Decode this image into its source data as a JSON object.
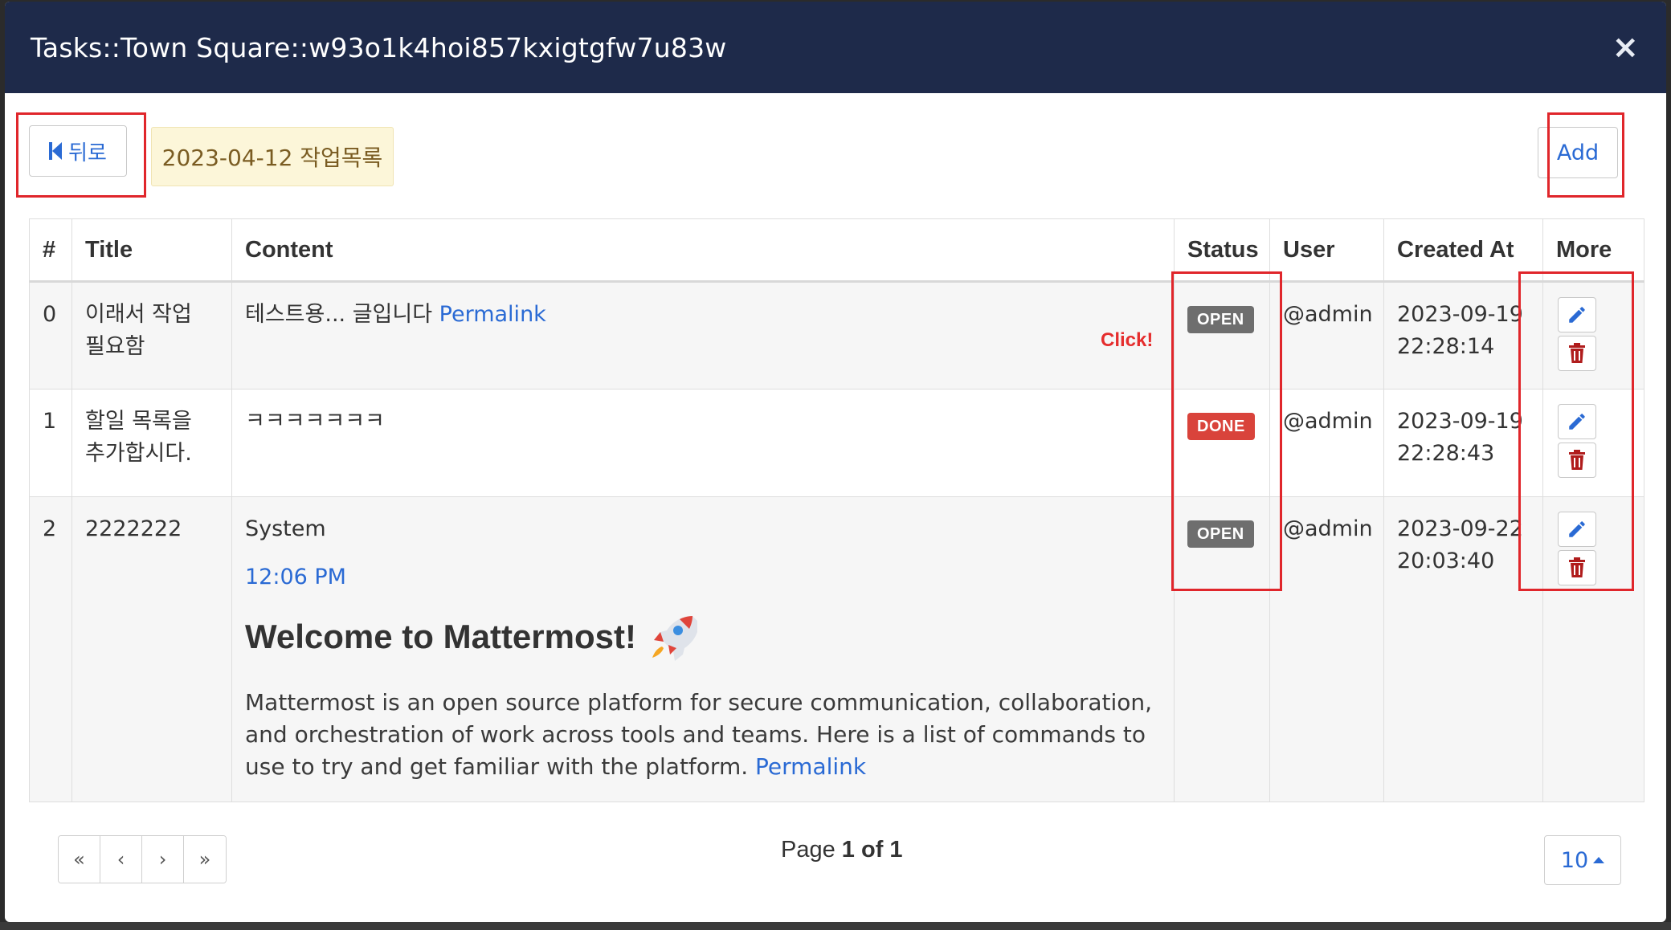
{
  "modal": {
    "title": "Tasks::Town Square::w93o1k4hoi857kxigtgfw7u83w",
    "close_label": "×"
  },
  "toolbar": {
    "back_label": "뒤로",
    "date_label": "2023-04-12 작업목록",
    "add_label": "Add"
  },
  "table": {
    "headers": [
      "#",
      "Title",
      "Content",
      "Status",
      "User",
      "Created At",
      "More"
    ],
    "rows": [
      {
        "num": "0",
        "title": "이래서 작업 필요함",
        "content": "테스트용... 글입니다",
        "content_link": "Permalink",
        "status": "OPEN",
        "user": "@admin",
        "created": "2023-09-19 22:28:14"
      },
      {
        "num": "1",
        "title": "할일 목록을 추가합시다.",
        "content": "ㅋㅋㅋㅋㅋㅋㅋ",
        "status": "DONE",
        "user": "@admin",
        "created": "2023-09-19 22:28:43"
      },
      {
        "num": "2",
        "title": "2222222",
        "content_sender": "System",
        "content_time": "12:06 PM",
        "content_heading": "Welcome to Mattermost!",
        "content_body": "Mattermost is an open source platform for secure communication, collaboration, and orchestration of work across tools and teams. Here is a list of commands to use to try and get familiar with the platform.",
        "content_link": "Permalink",
        "status": "OPEN",
        "user": "@admin",
        "created": "2023-09-22 20:03:40"
      }
    ]
  },
  "annotation": {
    "click_note": "Click!"
  },
  "pagination": {
    "first": "«",
    "prev": "‹",
    "next": "›",
    "last": "»",
    "page_prefix": "Page",
    "page_current": "1 of 1",
    "page_size": "10"
  },
  "colors": {
    "header_bg": "#1e2a4a",
    "link": "#2a6ad4",
    "badge_open": "#6e6e6e",
    "badge_done": "#d9433b",
    "annotation": "#e0262b"
  },
  "icons": [
    "step-back-icon",
    "pencil-icon",
    "trash-icon",
    "rocket-icon",
    "caret-up-icon"
  ]
}
